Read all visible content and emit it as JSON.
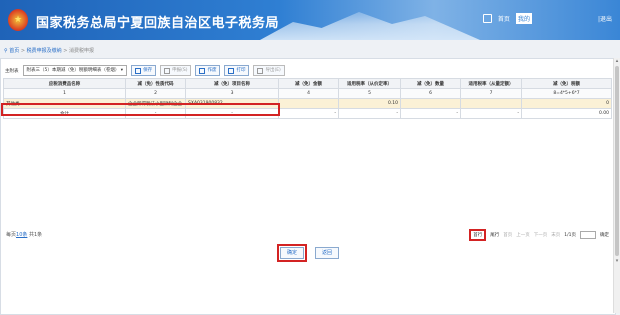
{
  "header": {
    "title": "国家税务总局宁夏回族自治区电子税务局",
    "nav": [
      "首页",
      "退出"
    ],
    "active_nav": "我的"
  },
  "breadcrumb": {
    "home": "首页",
    "mid": "税费申报及缴纳",
    "current": "消费税申报"
  },
  "toolbar": {
    "selected_label": "主附表",
    "selected_value": "附表三（5）本期减（免）税额明细表（卷烟）",
    "buttons": [
      "保存",
      "申报(S)",
      "作废",
      "打印",
      "导出(E)"
    ]
  },
  "table": {
    "headers": [
      "应税消费品名称",
      "减（免）性质代码",
      "减（免）项目名称",
      "减（免）金额",
      "适用税率（从价定率）",
      "减（免）数量",
      "适用税率（从量定额）",
      "减（免）税额"
    ],
    "col_numbers": [
      "1",
      "2",
      "3",
      "4",
      "5",
      "6",
      "7",
      "8=4*5+6*7"
    ],
    "row": {
      "name": "其他类",
      "code": "企业所得税法小型微利企业...",
      "project": "SXA031900832",
      "amount": "",
      "rate": "0.10",
      "qty": "",
      "unit_rate": "",
      "tax": "0"
    },
    "total": {
      "label": "合计",
      "code": "-",
      "project": "-",
      "amount": "-",
      "rate": "-",
      "qty": "-",
      "unit_rate": "-",
      "tax": "0.00"
    }
  },
  "pager": {
    "summary_prefix": "每页",
    "per_page": "10条",
    "summary_suffix": "共1条",
    "first": "首行",
    "prev_row": "尾行",
    "first_page": "首页",
    "prev": "上一页",
    "next": "下一页",
    "last": "末页",
    "page": "1/1页",
    "go": "确定"
  },
  "footer_buttons": {
    "confirm": "确定",
    "back": "返回"
  }
}
